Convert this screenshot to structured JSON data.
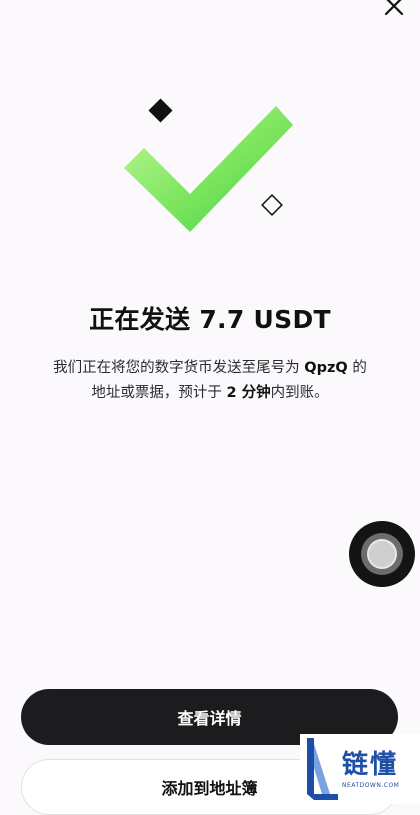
{
  "close_icon": "close-icon",
  "illustration": {
    "icon": "checkmark-icon",
    "check_color_start": "#b3f58a",
    "check_color_end": "#46d14a"
  },
  "title": "正在发送 7.7 USDT",
  "description": {
    "part1": "我们正在将您的数字货币发送至尾号为",
    "address_suffix": "QpzQ",
    "part2": "的",
    "part3": "地址或票据，预计于",
    "eta": "2 分钟",
    "part4": "内到账。"
  },
  "buttons": {
    "view_details": "查看详情",
    "add_to_address_book": "添加到地址簿"
  },
  "assistive_touch_icon": "assistive-touch-icon",
  "watermark": {
    "cn": "链懂",
    "en": "NEATDOWN.COM"
  },
  "colors": {
    "background": "#fcf9fd",
    "primary_button": "#1c1c1e",
    "check_green": "#6fe05a"
  }
}
